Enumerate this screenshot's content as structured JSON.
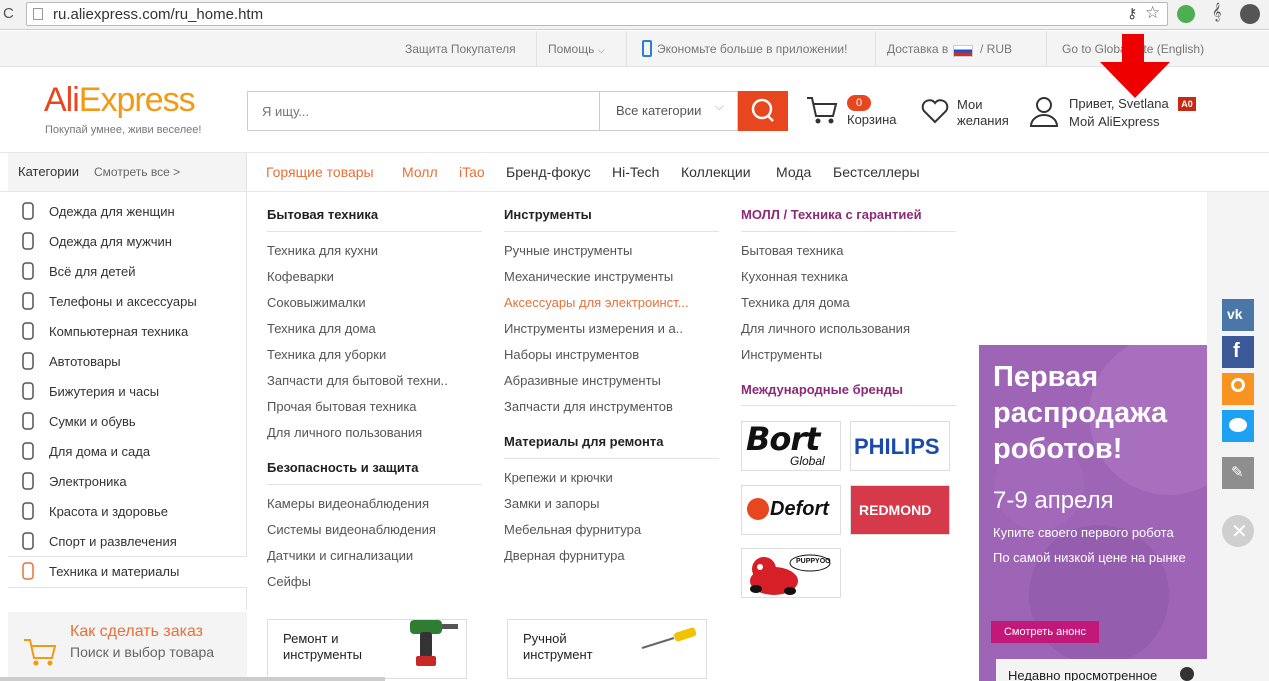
{
  "browser": {
    "url": "ru.aliexpress.com/ru_home.htm"
  },
  "topbar": {
    "buyer_protection": "Защита Покупателя",
    "help": "Помощь",
    "app_promo": "Экономьте больше в приложении!",
    "delivery": "Доставка в",
    "currency": "/ RUB",
    "global": "Go to Global Site (English)"
  },
  "header": {
    "logo": "AliExpress",
    "tagline": "Покупай умнее, живи веселее!",
    "search_placeholder": "Я ищу...",
    "category_select": "Все категории",
    "cart_count": "0",
    "cart_label": "Корзина",
    "wishlist_line1": "Мои",
    "wishlist_line2": "желания",
    "greeting": "Привет, Svetlana",
    "account_badge": "A0",
    "my_account": "Мой AliExpress"
  },
  "categories_head": {
    "title": "Категории",
    "see_all": "Смотреть все >"
  },
  "nav": [
    "Горящие товары",
    "Молл",
    "iTao",
    "Бренд-фокус",
    "Hi-Tech",
    "Коллекции",
    "Мода",
    "Бестселлеры"
  ],
  "sidebar": [
    "Одежда для женщин",
    "Одежда для мужчин",
    "Всё для детей",
    "Телефоны и аксессуары",
    "Компьютерная техника",
    "Автотовары",
    "Бижутерия и часы",
    "Сумки и обувь",
    "Для дома и сада",
    "Электроника",
    "Красота и здоровье",
    "Спорт и развлечения",
    "Техника и материалы"
  ],
  "col1": {
    "h1": "Бытовая техника",
    "l1": [
      "Техника для кухни",
      "Кофеварки",
      "Соковыжималки",
      "Техника для дома",
      "Техника для уборки",
      "Запчасти для бытовой техни..",
      "Прочая бытовая техника",
      "Для личного пользования"
    ],
    "h2": "Безопасность и защита",
    "l2": [
      "Камеры видеонаблюдения",
      "Системы видеонаблюдения",
      "Датчики и сигнализации",
      "Сейфы"
    ]
  },
  "col2": {
    "h1": "Инструменты",
    "l1": [
      "Ручные инструменты",
      "Механические инструменты",
      "Аксессуары для электроинст...",
      "Инструменты измерения и а..",
      "Наборы инструментов",
      "Абразивные инструменты",
      "Запчасти для инструментов"
    ],
    "h2": "Материалы для ремонта",
    "l2": [
      "Крепежи и крючки",
      "Замки и запоры",
      "Мебельная фурнитура",
      "Дверная фурнитура"
    ]
  },
  "col3": {
    "h1": "МОЛЛ / Техника с гарантией",
    "l1": [
      "Бытовая техника",
      "Кухонная техника",
      "Техника для дома",
      "Для личного использования",
      "Инструменты"
    ],
    "h2": "Международные бренды"
  },
  "brands": {
    "bort": "Bort",
    "bort_sub": "Global",
    "philips": "PHILIPS",
    "defort": "Defort",
    "redmond": "REDMOND",
    "puppyoo": "PUPPYOO"
  },
  "promo_cards": {
    "repair": "Ремонт и инструменты",
    "manual": "Ручной инструмент"
  },
  "howto": {
    "title": "Как сделать заказ",
    "subtitle": "Поиск и выбор товара"
  },
  "promo": {
    "title": "Первая распродажа роботов!",
    "dates": "7-9 апреля",
    "line1": "Купите своего первого робота",
    "line2": "По самой низкой цене на рынке",
    "button": "Смотреть анонс",
    "recently": "Недавно просмотренное"
  },
  "colors": {
    "accent": "#e8461f",
    "orange_text": "#e8703a",
    "mall_purple": "#8d2a78",
    "promo_bg": "#9e64b6"
  }
}
